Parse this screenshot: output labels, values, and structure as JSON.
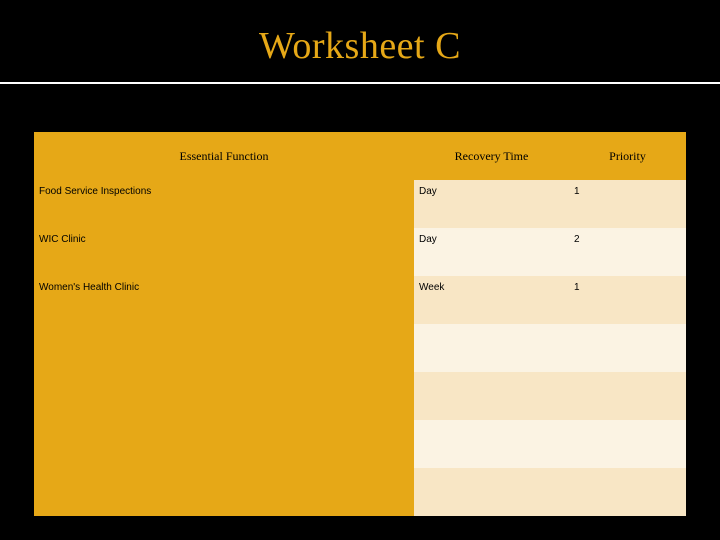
{
  "title": "Worksheet C",
  "table": {
    "headers": [
      "Essential Function",
      "Recovery Time",
      "Priority"
    ],
    "rows": [
      {
        "func": "Food Service Inspections",
        "time": "Day",
        "priority": "1"
      },
      {
        "func": "WIC Clinic",
        "time": "Day",
        "priority": "2"
      },
      {
        "func": "Women's Health Clinic",
        "time": "Week",
        "priority": "1"
      },
      {
        "func": "",
        "time": "",
        "priority": ""
      },
      {
        "func": "",
        "time": "",
        "priority": ""
      },
      {
        "func": "",
        "time": "",
        "priority": ""
      },
      {
        "func": "",
        "time": "",
        "priority": ""
      }
    ]
  }
}
